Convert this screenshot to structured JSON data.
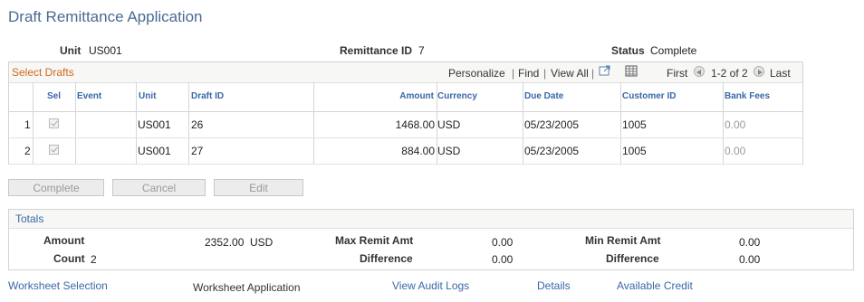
{
  "page": {
    "title": "Draft Remittance Application"
  },
  "header": {
    "unit_label": "Unit",
    "unit_value": "US001",
    "remit_label": "Remittance ID",
    "remit_value": "7",
    "status_label": "Status",
    "status_value": "Complete"
  },
  "grid": {
    "title": "Select Drafts",
    "personalize": "Personalize",
    "find": "Find",
    "view_all": "View All",
    "first": "First",
    "range": "1-2 of 2",
    "last": "Last",
    "columns": [
      "Sel",
      "Event",
      "Unit",
      "Draft ID",
      "Amount",
      "Currency",
      "Due Date",
      "Customer ID",
      "Bank Fees"
    ],
    "rows": [
      {
        "num": "1",
        "unit": "US001",
        "draft_id": "26",
        "amount": "1468.00",
        "currency": "USD",
        "due_date": "05/23/2005",
        "customer_id": "1005",
        "bank_fees": "0.00"
      },
      {
        "num": "2",
        "unit": "US001",
        "draft_id": "27",
        "amount": "884.00",
        "currency": "USD",
        "due_date": "05/23/2005",
        "customer_id": "1005",
        "bank_fees": "0.00"
      }
    ]
  },
  "buttons": {
    "complete": "Complete",
    "cancel": "Cancel",
    "edit": "Edit"
  },
  "totals": {
    "title": "Totals",
    "amount_label": "Amount",
    "amount_value": "2352.00",
    "amount_currency": "USD",
    "count_label": "Count",
    "count_value": "2",
    "max_remit_label": "Max Remit Amt",
    "max_remit_value": "0.00",
    "difference_label": "Difference",
    "difference_value": "0.00",
    "min_remit_label": "Min Remit Amt",
    "min_remit_value": "0.00",
    "difference2_label": "Difference",
    "difference2_value": "0.00"
  },
  "footer": {
    "worksheet_selection": "Worksheet Selection",
    "worksheet_application": "Worksheet Application",
    "view_audit_logs": "View Audit Logs",
    "details": "Details",
    "available_credit": "Available Credit"
  }
}
